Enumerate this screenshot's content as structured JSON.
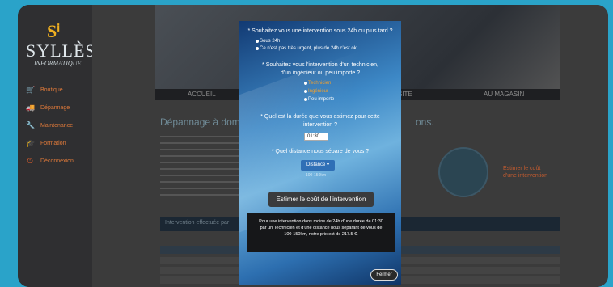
{
  "brand": {
    "mark": "Sⁱ",
    "name": "SYLLÈS",
    "subtitle": "INFORMATIQUE"
  },
  "sidebar": {
    "items": [
      {
        "label": "Boutique",
        "icon": "cart-icon"
      },
      {
        "label": "Dépannage",
        "icon": "truck-icon"
      },
      {
        "label": "Maintenance",
        "icon": "wrench-icon"
      },
      {
        "label": "Formation",
        "icon": "graduation-cap-icon"
      },
      {
        "label": "Déconnexion",
        "icon": "power-icon"
      }
    ],
    "accent": "#e8612c"
  },
  "menu": {
    "items": [
      "ACCUEIL",
      "SITE",
      "AU MAGASIN"
    ]
  },
  "page": {
    "title": "Dépannage à domic",
    "title_tail": "ons.",
    "banner": "Intervention effectuée par",
    "estimer_label_1": "Estimer le coût",
    "estimer_label_2": "d'une intervention"
  },
  "modal": {
    "q1": "* Souhaitez vous une intervention sous 24h ou plus tard ?",
    "q1_options": [
      "Sous 24h",
      "Ce n'est pas très urgent, plus de 24h c'est ok"
    ],
    "q2_line1": "* Souhaitez vous l'intervention d'un technicien,",
    "q2_line2": "d'un ingénieur ou peu importe ?",
    "q2_options": [
      "Technicien",
      "Ingénieur",
      "Peu importe"
    ],
    "q3_line1": "* Quel est la durée que vous estimez pour cette",
    "q3_line2": "intervention ?",
    "duration_value": "01:30",
    "q4": "* Quel distance nous sépare de vous ?",
    "distance_select": "Distance ▾",
    "distance_option": "100-150km",
    "estimate_button": "Estimer le coût de l'intervention",
    "result_line1": "Pour une intervention dans moins de 24h d'une durée de 01:30",
    "result_line2": "par un Technicien et d'une distance nous séparant de vous de",
    "result_line3": "100-150km, notre prix est de 217.5 €.",
    "close_button": "Fermer"
  }
}
